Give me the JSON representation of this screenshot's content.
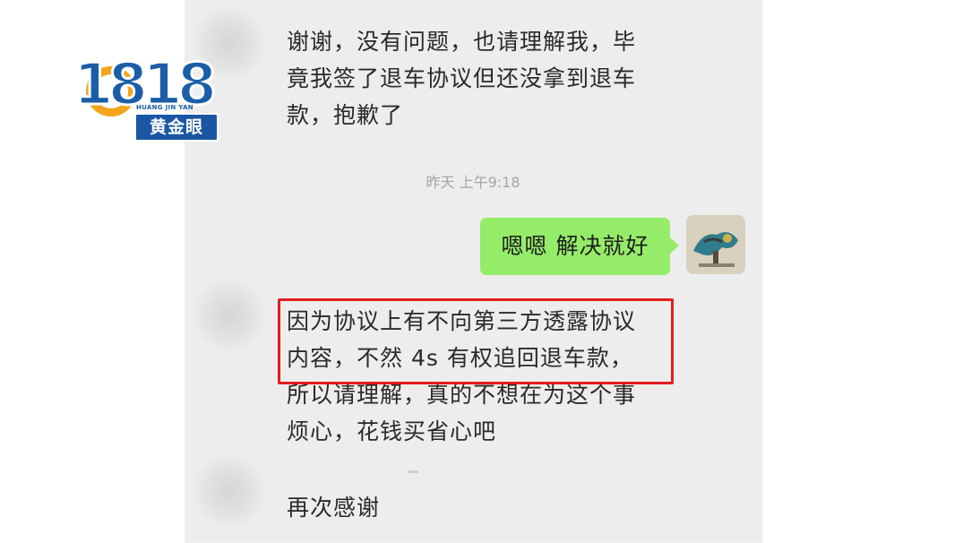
{
  "logo": {
    "digits": "1818",
    "pinyin": "HUANG JIN YAN",
    "name": "黄金眼"
  },
  "messages": [
    {
      "side": "left",
      "text": "谢谢，没有问题，也请理解我，毕\n竟我签了退车协议但还没拿到退车\n款，抱歉了"
    },
    {
      "side": "right",
      "text": "嗯嗯 解决就好"
    },
    {
      "side": "left",
      "text": "因为协议上有不向第三方透露协议\n内容，不然 4s 有权追回退车款，\n所以请理解，真的不想在为这个事\n烦心，花钱买省心吧"
    },
    {
      "side": "left",
      "text": "再次感谢"
    }
  ],
  "timestamp": "昨天 上午9:18",
  "colors": {
    "chat_background": "#ededed",
    "bubble_green": "#95ec69",
    "highlight_red": "#e11d1d",
    "logo_blue": "#1a5ea8",
    "logo_orange": "#f2a51c"
  },
  "icons": {
    "left_avatar": "blurred-avatar",
    "right_avatar": "user-photo-avatar"
  }
}
